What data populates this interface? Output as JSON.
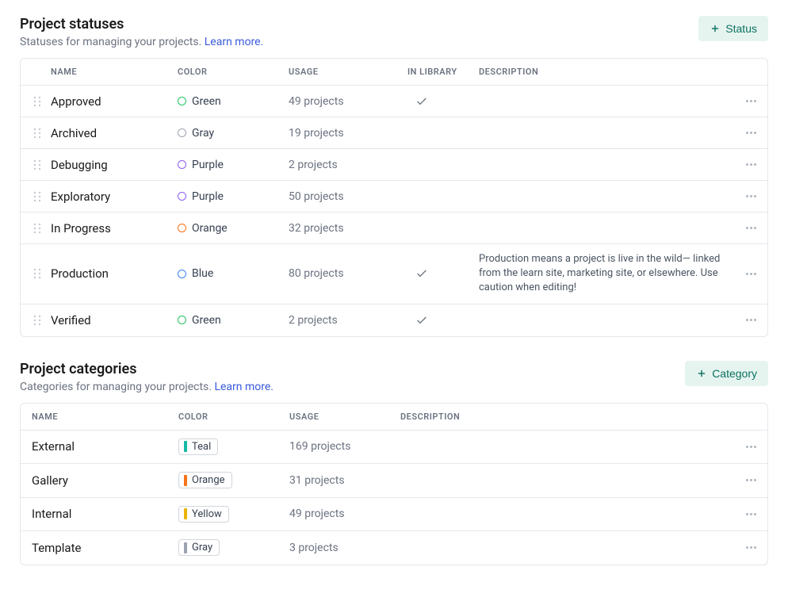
{
  "statuses": {
    "title": "Project statuses",
    "subtitle_prefix": "Statuses for managing your projects. ",
    "learn_more": "Learn more.",
    "add_button_label": "Status",
    "columns": {
      "name": "Name",
      "color": "Color",
      "usage": "Usage",
      "in_library": "In Library",
      "description": "Description"
    },
    "rows": [
      {
        "name": "Approved",
        "color_label": "Green",
        "color_hex": "#22c55e",
        "usage": "49 projects",
        "in_library": true,
        "description": ""
      },
      {
        "name": "Archived",
        "color_label": "Gray",
        "color_hex": "#9ca3af",
        "usage": "19 projects",
        "in_library": false,
        "description": ""
      },
      {
        "name": "Debugging",
        "color_label": "Purple",
        "color_hex": "#8b5cf6",
        "usage": "2 projects",
        "in_library": false,
        "description": ""
      },
      {
        "name": "Exploratory",
        "color_label": "Purple",
        "color_hex": "#8b5cf6",
        "usage": "50 projects",
        "in_library": false,
        "description": ""
      },
      {
        "name": "In Progress",
        "color_label": "Orange",
        "color_hex": "#f97316",
        "usage": "32 projects",
        "in_library": false,
        "description": ""
      },
      {
        "name": "Production",
        "color_label": "Blue",
        "color_hex": "#3b82f6",
        "usage": "80 projects",
        "in_library": true,
        "description": "Production means a project is live in the wild— linked from the learn site, marketing site, or elsewhere. Use caution when editing!"
      },
      {
        "name": "Verified",
        "color_label": "Green",
        "color_hex": "#22c55e",
        "usage": "2 projects",
        "in_library": true,
        "description": ""
      }
    ]
  },
  "categories": {
    "title": "Project categories",
    "subtitle_prefix": "Categories for managing your projects. ",
    "learn_more": "Learn more.",
    "add_button_label": "Category",
    "columns": {
      "name": "Name",
      "color": "Color",
      "usage": "Usage",
      "description": "Description"
    },
    "rows": [
      {
        "name": "External",
        "color_label": "Teal",
        "color_hex": "#14b8a6",
        "usage": "169 projects",
        "description": ""
      },
      {
        "name": "Gallery",
        "color_label": "Orange",
        "color_hex": "#f97316",
        "usage": "31 projects",
        "description": ""
      },
      {
        "name": "Internal",
        "color_label": "Yellow",
        "color_hex": "#eab308",
        "usage": "49 projects",
        "description": ""
      },
      {
        "name": "Template",
        "color_label": "Gray",
        "color_hex": "#9ca3af",
        "usage": "3 projects",
        "description": ""
      }
    ]
  }
}
